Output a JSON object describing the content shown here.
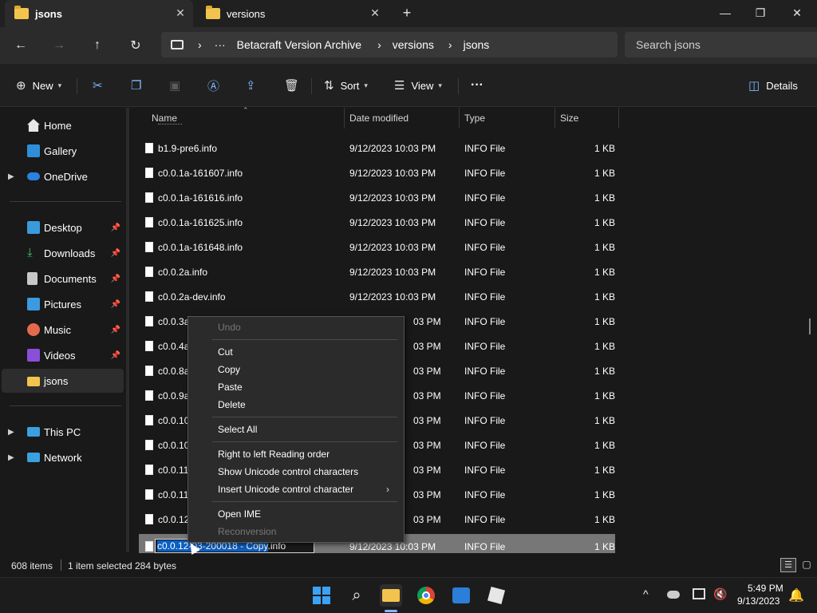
{
  "tabs": [
    {
      "label": "jsons",
      "active": true
    },
    {
      "label": "versions",
      "active": false
    }
  ],
  "window": {
    "minimize": "—",
    "maximize": "❐",
    "close": "✕",
    "new_tab": "+"
  },
  "nav": {
    "back": "←",
    "forward": "→",
    "up": "↑",
    "refresh": "↻"
  },
  "breadcrumb": {
    "root_icon": "monitor-icon",
    "ellipsis": "···",
    "items": [
      "Betacraft Version Archive",
      "versions",
      "jsons"
    ],
    "sep": "›"
  },
  "search": {
    "placeholder": "Search jsons"
  },
  "commands": {
    "new": "New",
    "sort": "Sort",
    "view": "View",
    "more": "···",
    "details": "Details"
  },
  "sidebar": {
    "home": "Home",
    "gallery": "Gallery",
    "onedrive": "OneDrive",
    "desktop": "Desktop",
    "downloads": "Downloads",
    "documents": "Documents",
    "pictures": "Pictures",
    "music": "Music",
    "videos": "Videos",
    "jsons": "jsons",
    "thispc": "This PC",
    "network": "Network"
  },
  "columns": {
    "name": "Name",
    "date": "Date modified",
    "type": "Type",
    "size": "Size"
  },
  "files": [
    {
      "name": "b1.9-pre6.info",
      "date": "9/12/2023 10:03 PM",
      "type": "INFO File",
      "size": "1 KB"
    },
    {
      "name": "c0.0.1a-161607.info",
      "date": "9/12/2023 10:03 PM",
      "type": "INFO File",
      "size": "1 KB"
    },
    {
      "name": "c0.0.1a-161616.info",
      "date": "9/12/2023 10:03 PM",
      "type": "INFO File",
      "size": "1 KB"
    },
    {
      "name": "c0.0.1a-161625.info",
      "date": "9/12/2023 10:03 PM",
      "type": "INFO File",
      "size": "1 KB"
    },
    {
      "name": "c0.0.1a-161648.info",
      "date": "9/12/2023 10:03 PM",
      "type": "INFO File",
      "size": "1 KB"
    },
    {
      "name": "c0.0.2a.info",
      "date": "9/12/2023 10:03 PM",
      "type": "INFO File",
      "size": "1 KB"
    },
    {
      "name": "c0.0.2a-dev.info",
      "date": "9/12/2023 10:03 PM",
      "type": "INFO File",
      "size": "1 KB"
    },
    {
      "name": "c0.0.3a",
      "date": "03 PM",
      "type": "INFO File",
      "size": "1 KB"
    },
    {
      "name": "c0.0.4a",
      "date": "03 PM",
      "type": "INFO File",
      "size": "1 KB"
    },
    {
      "name": "c0.0.8a",
      "date": "03 PM",
      "type": "INFO File",
      "size": "1 KB"
    },
    {
      "name": "c0.0.9a",
      "date": "03 PM",
      "type": "INFO File",
      "size": "1 KB"
    },
    {
      "name": "c0.0.10",
      "date": "03 PM",
      "type": "INFO File",
      "size": "1 KB"
    },
    {
      "name": "c0.0.10",
      "date": "03 PM",
      "type": "INFO File",
      "size": "1 KB"
    },
    {
      "name": "c0.0.11",
      "date": "03 PM",
      "type": "INFO File",
      "size": "1 KB"
    },
    {
      "name": "c0.0.11",
      "date": "03 PM",
      "type": "INFO File",
      "size": "1 KB"
    },
    {
      "name": "c0.0.12",
      "date": "03 PM",
      "type": "INFO File",
      "size": "1 KB"
    }
  ],
  "rename_row": {
    "selected_text": "c0.0.12",
    "mid_text": "-03-200018 - Copy",
    "suffix": ".info",
    "date": "9/12/2023 10:03 PM",
    "type": "INFO File",
    "size": "1 KB"
  },
  "context_menu": {
    "undo": "Undo",
    "cut": "Cut",
    "copy": "Copy",
    "paste": "Paste",
    "delete": "Delete",
    "select_all": "Select All",
    "rtl": "Right to left Reading order",
    "show_unicode": "Show Unicode control characters",
    "insert_unicode": "Insert Unicode control character",
    "open_ime": "Open IME",
    "reconversion": "Reconversion"
  },
  "status": {
    "items": "608 items",
    "selected": "1 item selected",
    "bytes": "284 bytes"
  },
  "taskbar": {
    "time": "5:49 PM",
    "date": "9/13/2023",
    "tray_chevron": "^"
  }
}
